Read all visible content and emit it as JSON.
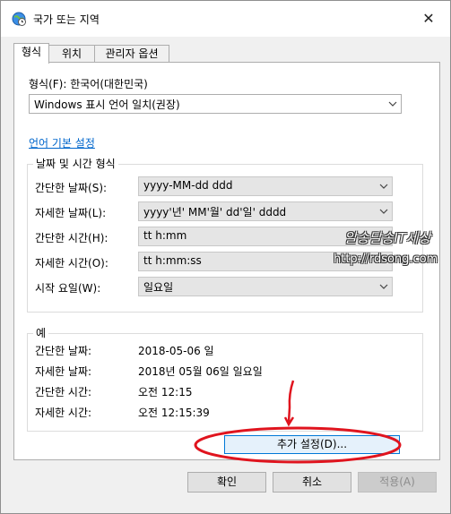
{
  "window": {
    "title": "국가 또는 지역",
    "close_glyph": "✕"
  },
  "tabs": [
    "형식",
    "위치",
    "관리자 옵션"
  ],
  "format": {
    "label": "형식(F): 한국어(대한민국)",
    "value": "Windows 표시 언어 일치(권장)"
  },
  "language_link": "언어 기본 설정",
  "datetime": {
    "title": "날짜 및 시간 형식",
    "rows": [
      {
        "label": "간단한 날짜(S):",
        "value": "yyyy-MM-dd ddd"
      },
      {
        "label": "자세한 날짜(L):",
        "value": "yyyy'년' MM'월' dd'일' dddd"
      },
      {
        "label": "간단한 시간(H):",
        "value": "tt h:mm"
      },
      {
        "label": "자세한 시간(O):",
        "value": "tt h:mm:ss"
      },
      {
        "label": "시작 요일(W):",
        "value": "일요일"
      }
    ]
  },
  "example": {
    "title": "예",
    "rows": [
      {
        "label": "간단한 날짜:",
        "value": "2018-05-06 일"
      },
      {
        "label": "자세한 날짜:",
        "value": "2018년 05월 06일 일요일"
      },
      {
        "label": "간단한 시간:",
        "value": "오전 12:15"
      },
      {
        "label": "자세한 시간:",
        "value": "오전 12:15:39"
      }
    ]
  },
  "additional_settings": "추가 설정(D)...",
  "buttons": {
    "ok": "확인",
    "cancel": "취소",
    "apply": "적용(A)"
  },
  "watermark": {
    "line1": "알송달송IT세상",
    "line2": "http://rdsong.com"
  },
  "colors": {
    "link": "#0066cc",
    "annotation": "#e0141e",
    "focus": "#0078d7"
  },
  "icons": {
    "title": "globe-clock-icon",
    "dropdown": "chevron-down-icon",
    "close": "close-icon"
  }
}
